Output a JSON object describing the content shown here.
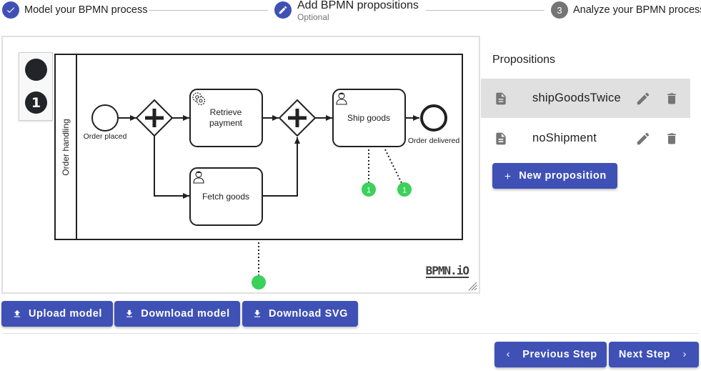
{
  "stepper": {
    "steps": [
      {
        "label": "Model your BPMN process",
        "state": "completed"
      },
      {
        "label": "Add BPMN propositions",
        "sublabel": "Optional",
        "state": "active"
      },
      {
        "label": "Analyze your BPMN process",
        "number": "3",
        "state": "inactive"
      }
    ]
  },
  "palette": {
    "items": [
      {
        "icon": "filled-circle-icon",
        "glyph": ""
      },
      {
        "icon": "numbered-badge-icon",
        "glyph": "1"
      }
    ]
  },
  "diagram": {
    "pool_label": "Order handling",
    "start_event": "Order placed",
    "end_event": "Order delivered",
    "tasks": {
      "retrieve_payment": [
        "Retrieve",
        "payment"
      ],
      "fetch_goods": "Fetch goods",
      "ship_goods": "Ship goods"
    },
    "badges": [
      "1",
      "1"
    ],
    "logo": "BPMN.iO"
  },
  "model_actions": {
    "upload": "Upload model",
    "download": "Download model",
    "download_svg": "Download SVG"
  },
  "propositions": {
    "title": "Propositions",
    "items": [
      {
        "name": "shipGoodsTwice",
        "selected": true
      },
      {
        "name": "noShipment",
        "selected": false
      }
    ],
    "new_label": "New proposition"
  },
  "navigation": {
    "previous": "Previous Step",
    "next": "Next Step"
  },
  "colors": {
    "primary": "#3f51b5",
    "inactive_step": "#757575",
    "selected_row": "#e0e0e0",
    "badge_green": "#3bd15a"
  }
}
